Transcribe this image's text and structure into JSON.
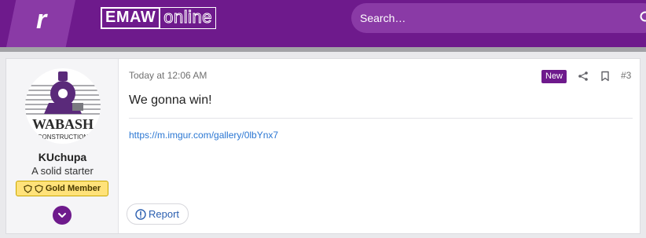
{
  "header": {
    "logo_letter": "r",
    "site_title_part1": "EMAW",
    "site_title_part2": "online",
    "search_placeholder": "Search…"
  },
  "post": {
    "author": {
      "username": "KUchupa",
      "user_title": "A solid starter",
      "badge_label": "Gold Member",
      "avatar_text": "WABASH",
      "avatar_subtext": "CONSTRUCTION"
    },
    "timestamp": "Today at 12:06 AM",
    "new_label": "New",
    "post_number": "#3",
    "message": "We gonna win!",
    "signature_link": "https://m.imgur.com/gallery/0lbYnx7",
    "report_label": "Report"
  },
  "colors": {
    "brand_purple": "#6e1a8c",
    "search_purple": "#8a3aa6",
    "gold_badge": "#ffe27a",
    "link_blue": "#2b77d3"
  },
  "icons": [
    "search-icon",
    "shield-icon",
    "chevron-down-icon",
    "share-icon",
    "bookmark-icon",
    "info-icon"
  ]
}
